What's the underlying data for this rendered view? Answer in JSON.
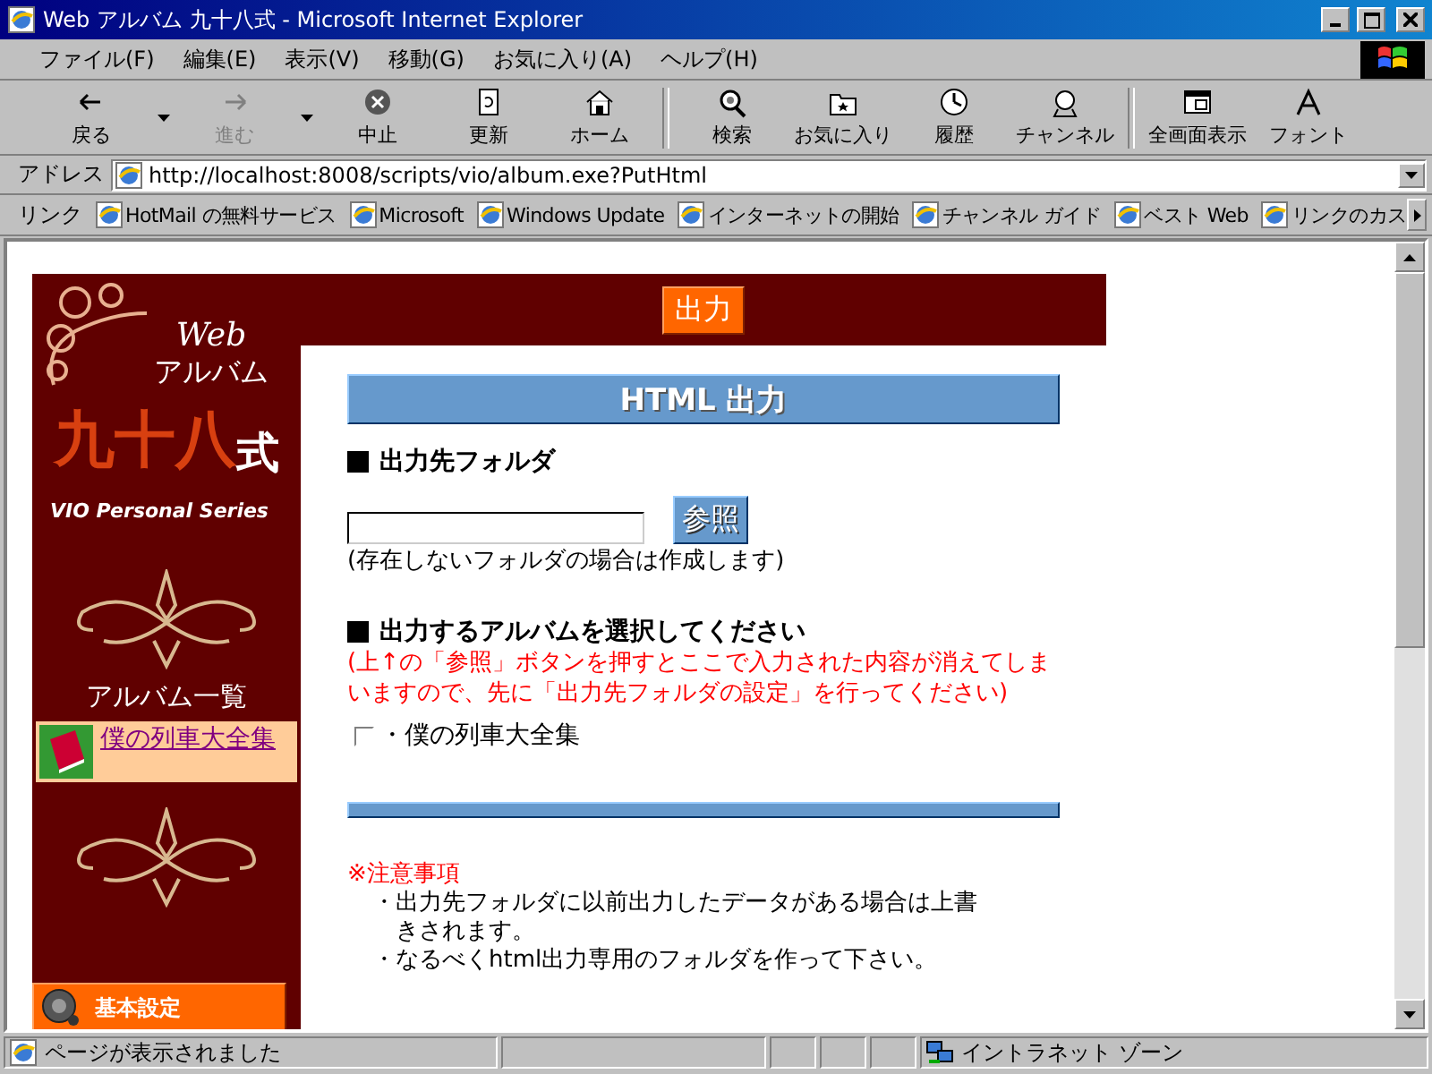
{
  "window": {
    "title": "Web アルバム 九十八式 - Microsoft Internet Explorer"
  },
  "menu": [
    "ファイル(F)",
    "編集(E)",
    "表示(V)",
    "移動(G)",
    "お気に入り(A)",
    "ヘルプ(H)"
  ],
  "toolbar": [
    {
      "kind": "back",
      "label": "戻る",
      "disabled": false,
      "dropdown": true
    },
    {
      "kind": "forward",
      "label": "進む",
      "disabled": true,
      "dropdown": true
    },
    {
      "kind": "stop",
      "label": "中止",
      "disabled": false,
      "dropdown": false
    },
    {
      "kind": "refresh",
      "label": "更新",
      "disabled": false,
      "dropdown": false
    },
    {
      "kind": "home",
      "label": "ホーム",
      "disabled": false,
      "dropdown": false
    },
    {
      "kind": "search",
      "label": "検索",
      "disabled": false,
      "dropdown": false
    },
    {
      "kind": "favorites",
      "label": "お気に入り",
      "disabled": false,
      "dropdown": false
    },
    {
      "kind": "history",
      "label": "履歴",
      "disabled": false,
      "dropdown": false
    },
    {
      "kind": "channels",
      "label": "チャンネル",
      "disabled": false,
      "dropdown": false
    },
    {
      "kind": "fullscreen",
      "label": "全画面表示",
      "disabled": false,
      "dropdown": false
    },
    {
      "kind": "font",
      "label": "フォント",
      "disabled": false,
      "dropdown": false
    }
  ],
  "address": {
    "label": "アドレス",
    "value": "http://localhost:8008/scripts/vio/album.exe?PutHtml"
  },
  "links": {
    "label": "リンク",
    "items": [
      "HotMail の無料サービス",
      "Microsoft",
      "Windows Update",
      "インターネットの開始",
      "チャンネル ガイド",
      "ベスト Web",
      "リンクのカス"
    ]
  },
  "page": {
    "logo": {
      "web": "Web",
      "album": "アルバム",
      "mark": "九十八",
      "suffix": "式",
      "series": "VIO Personal Series"
    },
    "top_button": "出力",
    "sidebar": {
      "album_list_title": "アルバム一覧",
      "albums": [
        {
          "name": "僕の列車大全集",
          "selected": true
        }
      ],
      "menu": [
        {
          "label": "基本設定"
        }
      ]
    },
    "heading": "HTML 出力",
    "folder": {
      "title": "出力先フォルダ",
      "placeholder_note": "(存在しないフォルダの場合は作成します)",
      "browse_button": "参照"
    },
    "albums_section": {
      "title": "出力するアルバムを選択してください",
      "warning": "(上↑の「参照」ボタンを押すとここで入力された内容が消えてしまいますので、先に「出力先フォルダの設定」を行ってください)",
      "items": [
        {
          "label": "・僕の列車大全集",
          "checked": false
        }
      ]
    },
    "notes": {
      "title": "※注意事項",
      "items": [
        "・出力先フォルダに以前出力したデータがある場合は上書きされます。",
        "・なるべくhtml出力専用のフォルダを作って下さい。"
      ]
    }
  },
  "status": {
    "text": "ページが表示されました",
    "zone": "イントラネット ゾーン"
  }
}
